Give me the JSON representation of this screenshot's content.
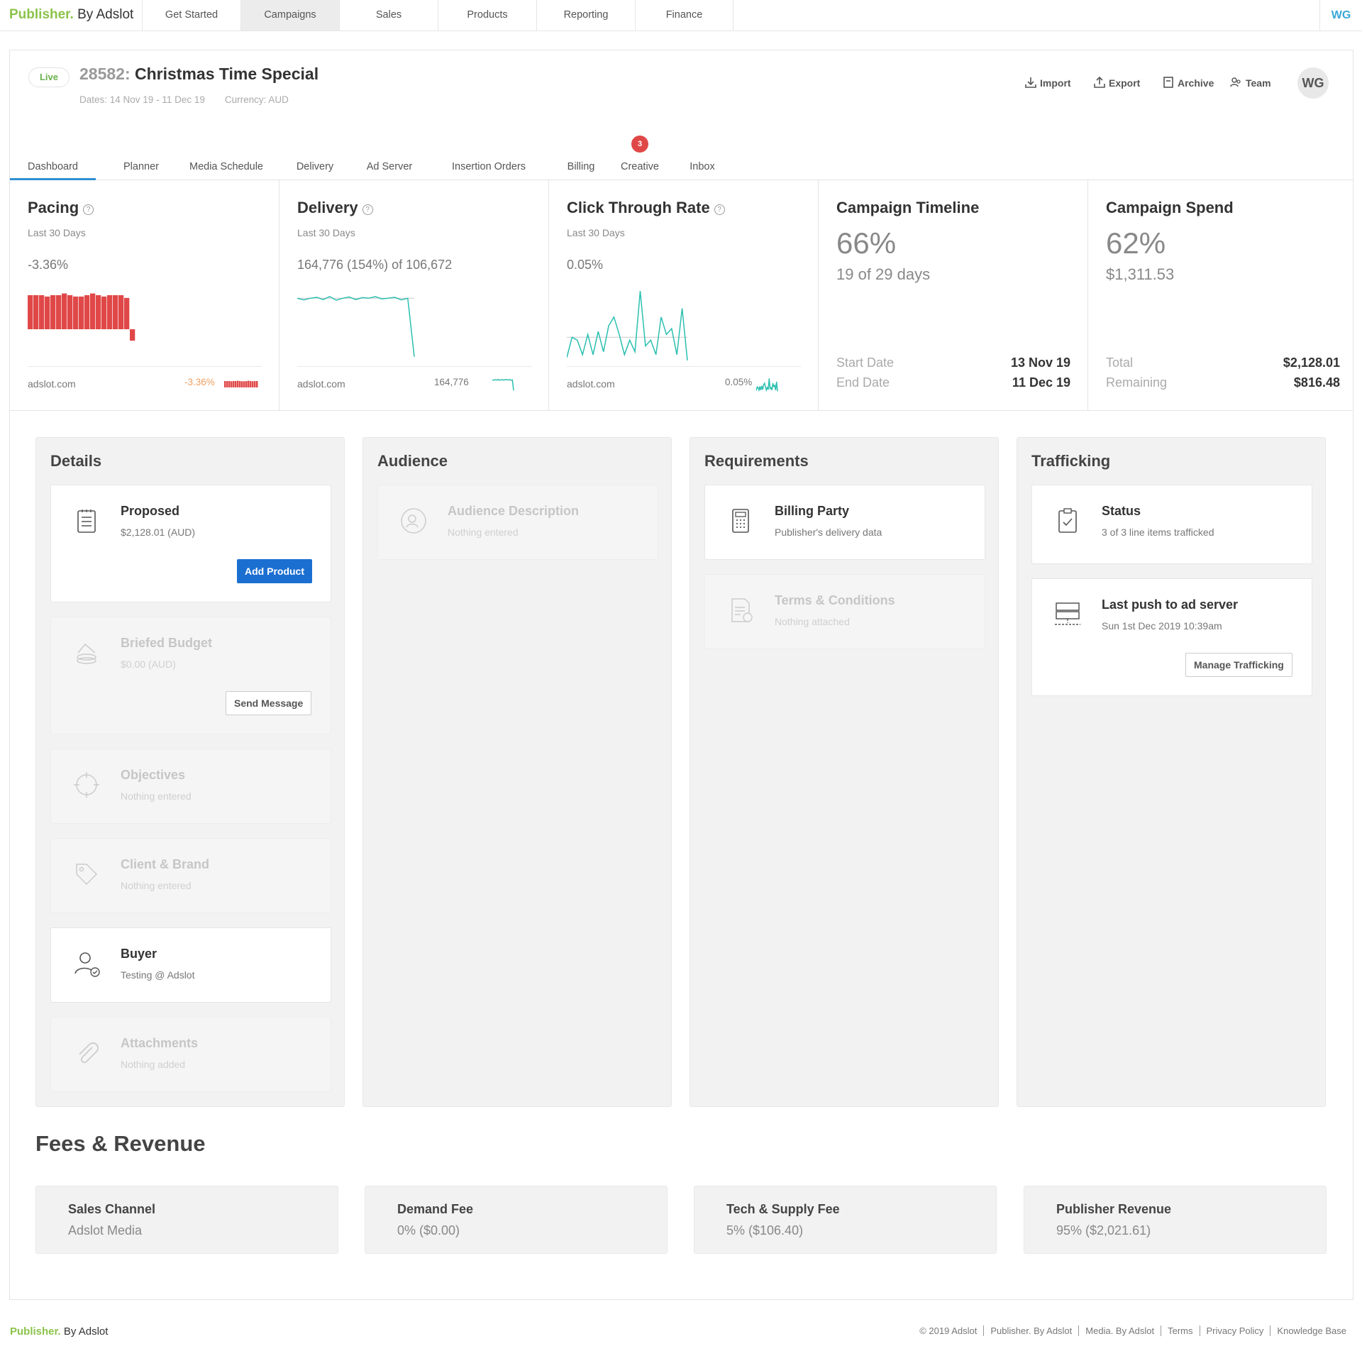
{
  "app": {
    "logo_brand": "Publisher.",
    "logo_rest": " By Adslot",
    "user_initials": "WG"
  },
  "topnav": [
    "Get Started",
    "Campaigns",
    "Sales",
    "Products",
    "Reporting",
    "Finance"
  ],
  "campaign": {
    "status": "Live",
    "id": "28582:",
    "name": "Christmas Time Special",
    "dates": "Dates: 14 Nov 19  -  11 Dec 19",
    "currency": "Currency: AUD"
  },
  "actions": {
    "import": "Import",
    "export": "Export",
    "archive": "Archive",
    "team": "Team",
    "avatar": "WG"
  },
  "tabs": [
    "Dashboard",
    "Planner",
    "Media Schedule",
    "Delivery",
    "Ad Server",
    "Insertion Orders",
    "Billing",
    "Creative",
    "Inbox"
  ],
  "creative_badge": "3",
  "metrics": {
    "pacing": {
      "title": "Pacing",
      "period": "Last 30 Days",
      "value": "-3.36%",
      "source": "adslot.com",
      "source_value": "-3.36%"
    },
    "delivery": {
      "title": "Delivery",
      "period": "Last 30 Days",
      "value": "164,776 (154%) of 106,672",
      "source": "adslot.com",
      "source_value": "164,776"
    },
    "ctr": {
      "title": "Click Through Rate",
      "period": "Last 30 Days",
      "value": "0.05%",
      "source": "adslot.com",
      "source_value": "0.05%"
    },
    "timeline": {
      "title": "Campaign Timeline",
      "percent": "66%",
      "sub": "19 of 29 days",
      "start_label": "Start Date",
      "start": "13 Nov 19",
      "end_label": "End Date",
      "end": "11 Dec 19"
    },
    "spend": {
      "title": "Campaign Spend",
      "percent": "62%",
      "sub": "$1,311.53",
      "total_label": "Total",
      "total": "$2,128.01",
      "remaining_label": "Remaining",
      "remaining": "$816.48"
    }
  },
  "chart_data": [
    {
      "type": "bar",
      "title": "Pacing",
      "values": [
        10,
        10,
        10,
        9.6,
        10,
        10,
        10.5,
        10,
        9.6,
        9.6,
        10,
        10.5,
        10,
        9.6,
        10,
        10,
        10,
        9.2,
        -3.36
      ],
      "colors": [
        "#e04848"
      ]
    },
    {
      "type": "line",
      "title": "Delivery",
      "values": [
        10,
        9.5,
        10,
        10.3,
        9.6,
        10.5,
        9.4,
        10,
        10.4,
        9.6,
        10.2,
        10,
        10.5,
        9.8,
        10,
        10.3,
        9.5,
        10,
        -8
      ]
    },
    {
      "type": "line",
      "title": "Click Through Rate",
      "values": [
        1,
        8,
        7,
        2,
        9,
        2,
        10,
        3,
        12,
        15,
        9,
        2,
        7,
        3,
        24,
        5,
        7,
        2,
        15,
        9,
        11,
        2,
        18,
        0
      ]
    }
  ],
  "details": {
    "title": "Details",
    "proposed": {
      "title": "Proposed",
      "sub": "$2,128.01 (AUD)",
      "button": "Add Product"
    },
    "briefed": {
      "title": "Briefed Budget",
      "sub": "$0.00 (AUD)",
      "button": "Send Message"
    },
    "objectives": {
      "title": "Objectives",
      "sub": "Nothing entered"
    },
    "client": {
      "title": "Client & Brand",
      "sub": "Nothing entered"
    },
    "buyer": {
      "title": "Buyer",
      "sub": "Testing @ Adslot"
    },
    "attachments": {
      "title": "Attachments",
      "sub": "Nothing added"
    }
  },
  "audience": {
    "title": "Audience",
    "desc": {
      "title": "Audience Description",
      "sub": "Nothing entered"
    }
  },
  "requirements": {
    "title": "Requirements",
    "billing": {
      "title": "Billing Party",
      "sub": "Publisher's delivery data"
    },
    "terms": {
      "title": "Terms & Conditions",
      "sub": "Nothing attached"
    }
  },
  "trafficking": {
    "title": "Trafficking",
    "status": {
      "title": "Status",
      "sub": "3 of 3 line items trafficked"
    },
    "push": {
      "title": "Last push to ad server",
      "sub": "Sun 1st Dec 2019 10:39am",
      "button": "Manage Trafficking"
    }
  },
  "fees": {
    "title": "Fees & Revenue",
    "items": [
      {
        "title": "Sales Channel",
        "value": "Adslot Media"
      },
      {
        "title": "Demand Fee",
        "value": "0% ($0.00)"
      },
      {
        "title": "Tech & Supply Fee",
        "value": "5% ($106.40)"
      },
      {
        "title": "Publisher Revenue",
        "value": "95% ($2,021.61)"
      }
    ]
  },
  "footer": {
    "logo_brand": "Publisher.",
    "logo_rest": " By Adslot",
    "links": [
      "© 2019 Adslot",
      "Publisher. By Adslot",
      "Media. By Adslot",
      "Terms",
      "Privacy Policy",
      "Knowledge Base"
    ]
  }
}
